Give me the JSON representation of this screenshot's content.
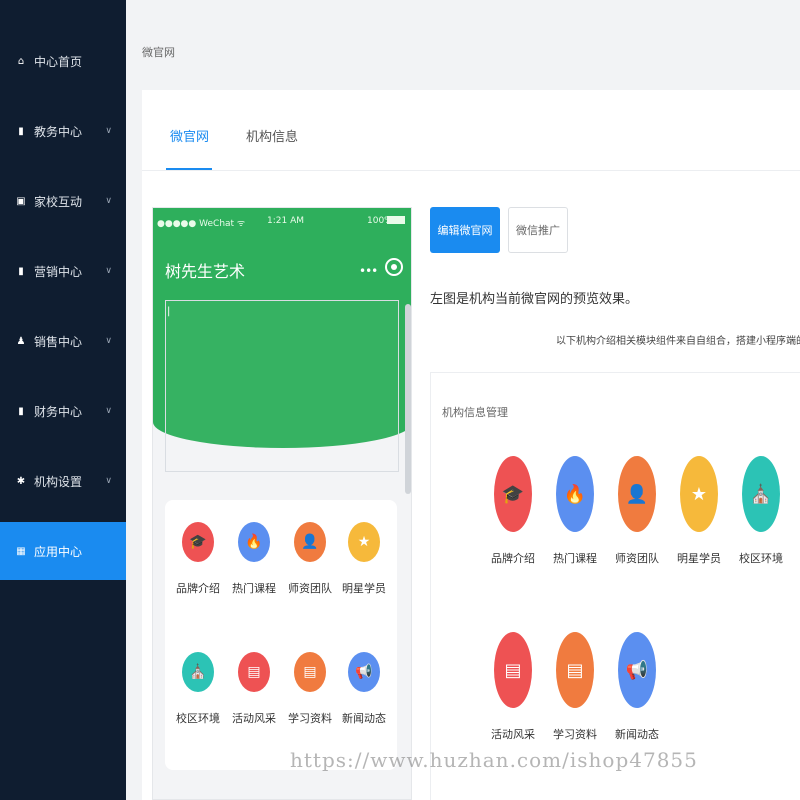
{
  "breadcrumb": "微官网",
  "sidebar": {
    "items": [
      {
        "label": "中心首页",
        "icon": "home-icon",
        "glyph": "⌂",
        "chevron": false,
        "active": false
      },
      {
        "label": "教务中心",
        "icon": "book-icon",
        "glyph": "▮",
        "chevron": true,
        "active": false
      },
      {
        "label": "家校互动",
        "icon": "chat-icon",
        "glyph": "▣",
        "chevron": true,
        "active": false
      },
      {
        "label": "营销中心",
        "icon": "bag-icon",
        "glyph": "▮",
        "chevron": true,
        "active": false
      },
      {
        "label": "销售中心",
        "icon": "user-icon",
        "glyph": "♟",
        "chevron": true,
        "active": false
      },
      {
        "label": "财务中心",
        "icon": "wallet-icon",
        "glyph": "▮",
        "chevron": true,
        "active": false
      },
      {
        "label": "机构设置",
        "icon": "gear-icon",
        "glyph": "✱",
        "chevron": true,
        "active": false
      },
      {
        "label": "应用中心",
        "icon": "grid-icon",
        "glyph": "▦",
        "chevron": false,
        "active": true
      }
    ]
  },
  "tabs": [
    {
      "label": "微官网",
      "active": true
    },
    {
      "label": "机构信息",
      "active": false
    }
  ],
  "phone": {
    "carrier": "●●●●● WeChat ᯤ",
    "time": "1:21 AM",
    "battery": "100%",
    "title": "树先生艺术",
    "banner_caret": "|"
  },
  "buttons": {
    "edit": "编辑微官网",
    "promote": "微信推广"
  },
  "description": "左图是机构当前微官网的预览效果。",
  "note": "以下机构介绍相关模块组件来自自组合，搭建小程序端的",
  "card_title": "机构信息管理",
  "modules": [
    {
      "label": "品牌介绍",
      "icon": "graduation-cap-icon",
      "glyph": "🎓",
      "color": "#ee5253"
    },
    {
      "label": "热门课程",
      "icon": "flame-icon",
      "glyph": "🔥",
      "color": "#5b8ff0"
    },
    {
      "label": "师资团队",
      "icon": "teacher-icon",
      "glyph": "👤",
      "color": "#f07b3f"
    },
    {
      "label": "明星学员",
      "icon": "star-icon",
      "glyph": "★",
      "color": "#f6b93b"
    },
    {
      "label": "校区环境",
      "icon": "school-icon",
      "glyph": "⛪",
      "color": "#2cc3b5"
    },
    {
      "label": "活动风采",
      "icon": "flag-icon",
      "glyph": "▤",
      "color": "#ee5253"
    },
    {
      "label": "学习资料",
      "icon": "document-icon",
      "glyph": "▤",
      "color": "#f07b3f"
    },
    {
      "label": "新闻动态",
      "icon": "megaphone-icon",
      "glyph": "📢",
      "color": "#5b8ff0"
    }
  ],
  "watermark": "https://www.huzhan.com/ishop47855"
}
